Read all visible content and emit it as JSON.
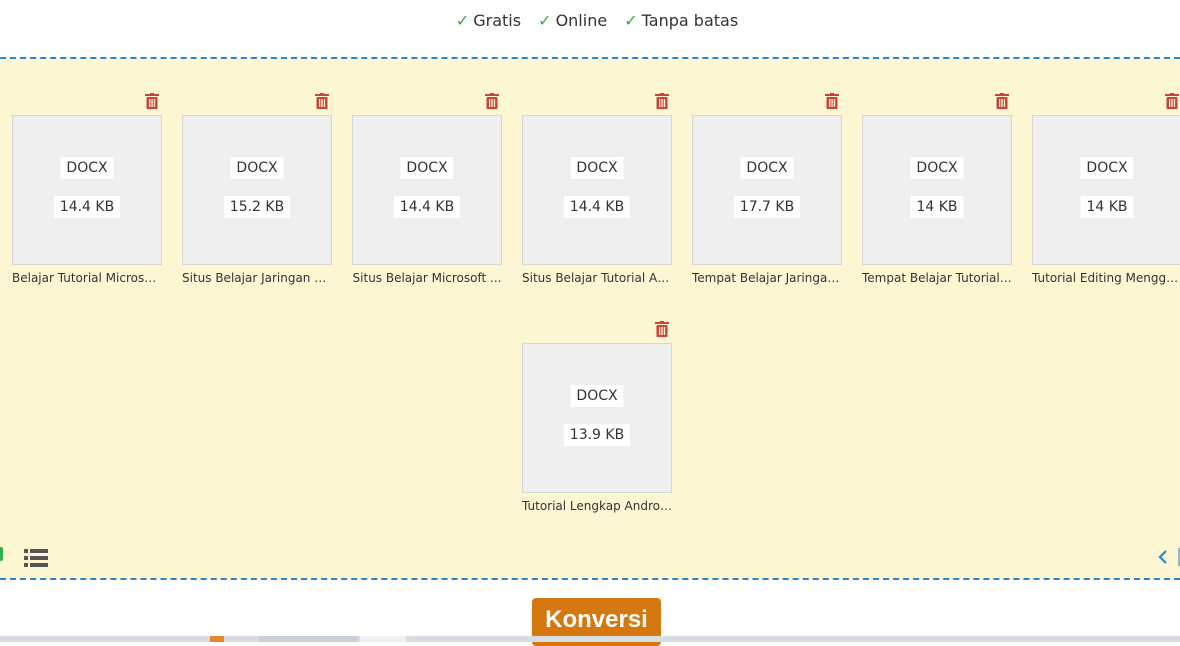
{
  "features": [
    "Gratis",
    "Online",
    "Tanpa batas"
  ],
  "files": [
    {
      "type": "DOCX",
      "size": "14.4 KB",
      "name": "Belajar Tutorial Microsof..."
    },
    {
      "type": "DOCX",
      "size": "15.2 KB",
      "name": "Situs Belajar Jaringan Ko..."
    },
    {
      "type": "DOCX",
      "size": "14.4 KB",
      "name": "Situs Belajar Microsoft ..."
    },
    {
      "type": "DOCX",
      "size": "14.4 KB",
      "name": "Situs Belajar Tutorial Apl..."
    },
    {
      "type": "DOCX",
      "size": "17.7 KB",
      "name": "Tempat Belajar Jaringan ..."
    },
    {
      "type": "DOCX",
      "size": "14 KB",
      "name": "Tempat Belajar Tutorial ..."
    },
    {
      "type": "DOCX",
      "size": "14 KB",
      "name": "Tutorial Editing Menggu..."
    },
    {
      "type": "DOCX",
      "size": "13.9 KB",
      "name": "Tutorial Lengkap Androi..."
    }
  ],
  "convert_label": "Konversi",
  "colors": {
    "check": "#3aa845",
    "dropzone_bg": "#fdf6d3",
    "dashed_border": "#2a86c9",
    "trash": "#c8433a",
    "convert_button": "#d4780f"
  }
}
